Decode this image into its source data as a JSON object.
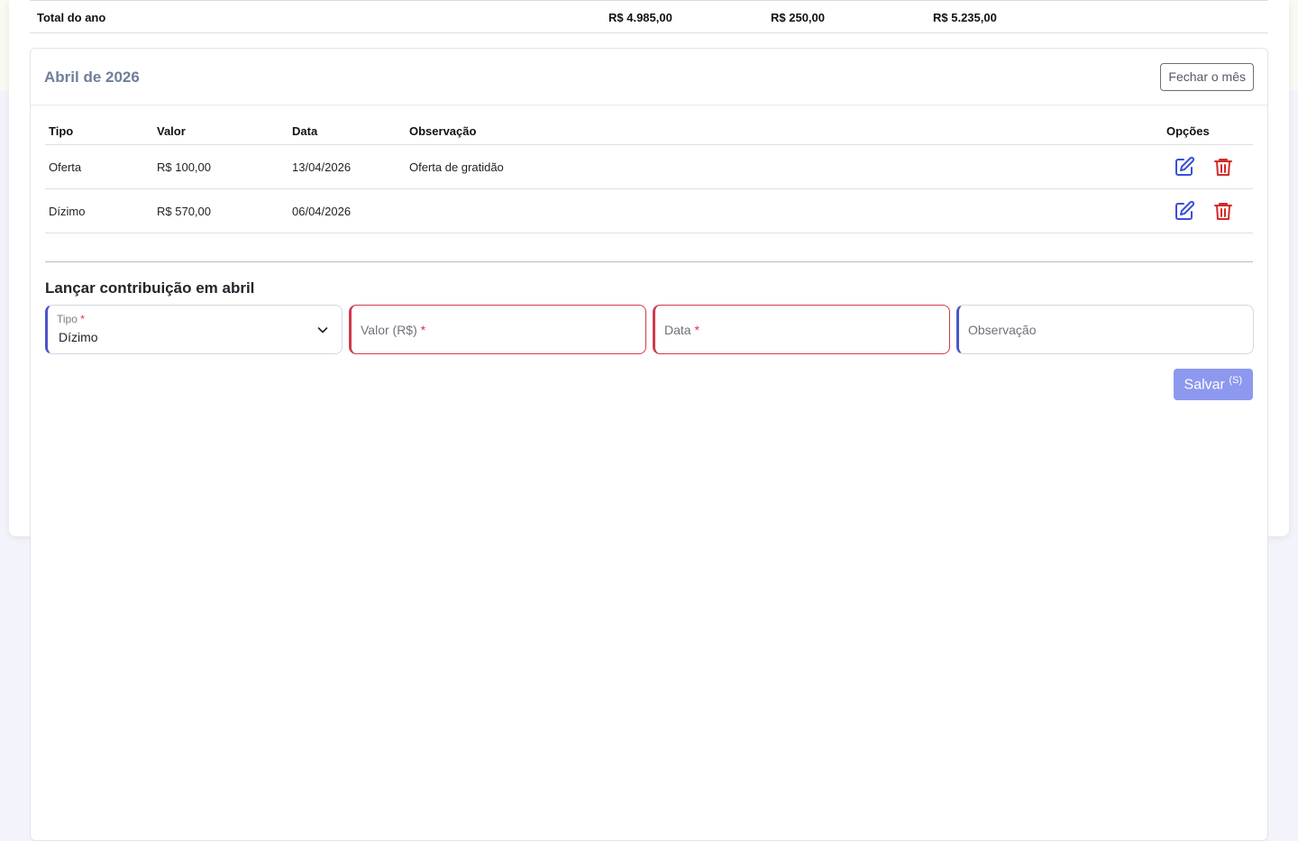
{
  "totals": {
    "label": "Total do ano",
    "col1": "R$ 4.985,00",
    "col2": "R$ 250,00",
    "col3": "R$ 5.235,00"
  },
  "month_panel": {
    "title": "Abril de 2026",
    "close_button": "Fechar o mês",
    "table": {
      "headers": [
        "Tipo",
        "Valor",
        "Data",
        "Observação",
        "Opções"
      ],
      "rows": [
        {
          "tipo": "Oferta",
          "valor": "R$ 100,00",
          "data": "13/04/2026",
          "observacao": "Oferta de gratidão"
        },
        {
          "tipo": "Dízimo",
          "valor": "R$ 570,00",
          "data": "06/04/2026",
          "observacao": ""
        }
      ]
    },
    "form": {
      "title": "Lançar contribuição em abril",
      "tipo_label": "Tipo",
      "tipo_value": "Dízimo",
      "valor_placeholder": "Valor (R$)",
      "data_placeholder": "Data",
      "obs_placeholder": "Observação",
      "required_mark": "*",
      "save_label": "Salvar",
      "save_shortcut": "(S)"
    }
  },
  "icons": {
    "edit": "edit-icon",
    "delete": "trash-icon",
    "chevron": "chevron-down-icon"
  },
  "colors": {
    "accent": "#4b55c8",
    "danger": "#d03a4c",
    "save_button": "#8d98ef",
    "title_muted": "#6f7e9c"
  }
}
